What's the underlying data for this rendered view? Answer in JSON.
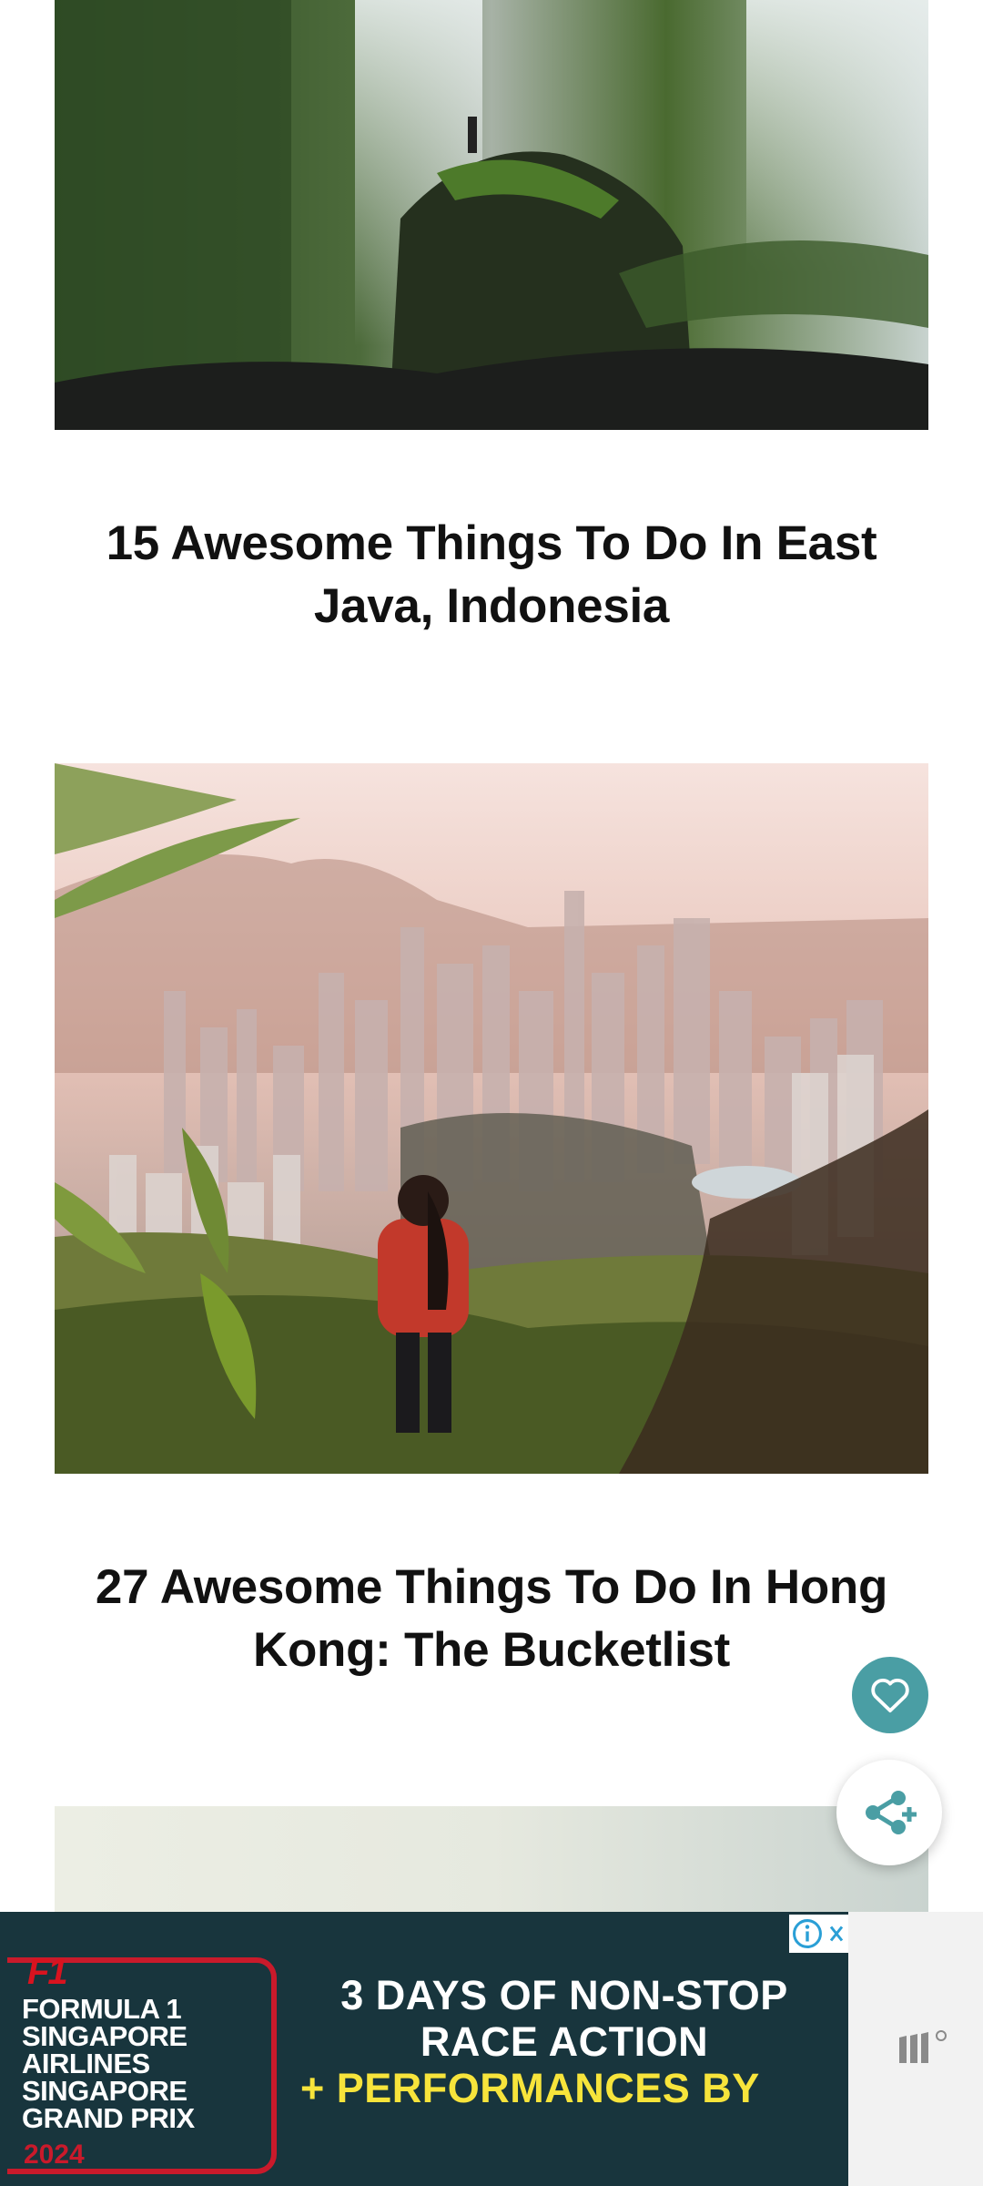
{
  "articles": [
    {
      "title": "15 Awesome Things To Do In East Java, Indonesia",
      "image": "waterfall-photo"
    },
    {
      "title": "27 Awesome Things To Do In Hong Kong: The Bucketlist",
      "image": "hong-kong-skyline-photo"
    },
    {
      "title": "",
      "image": "sky-photo"
    }
  ],
  "fabs": {
    "favorite_icon": "heart-icon",
    "share_icon": "share-icon"
  },
  "ad": {
    "brand_lines": [
      "FORMULA 1",
      "SINGAPORE",
      "AIRLINES",
      "SINGAPORE",
      "GRAND PRIX"
    ],
    "year": "2024",
    "logo": "F1",
    "line1": "3 DAYS OF NON-STOP",
    "line2": "RACE ACTION",
    "line3": "+ PERFORMANCES BY",
    "info_icon": "info-icon",
    "close_icon": "close-icon"
  },
  "colors": {
    "accent": "#4a9ea4",
    "ad_bg": "#18353d",
    "ad_highlight": "#f7e43b",
    "f1_red": "#c91a2b"
  }
}
